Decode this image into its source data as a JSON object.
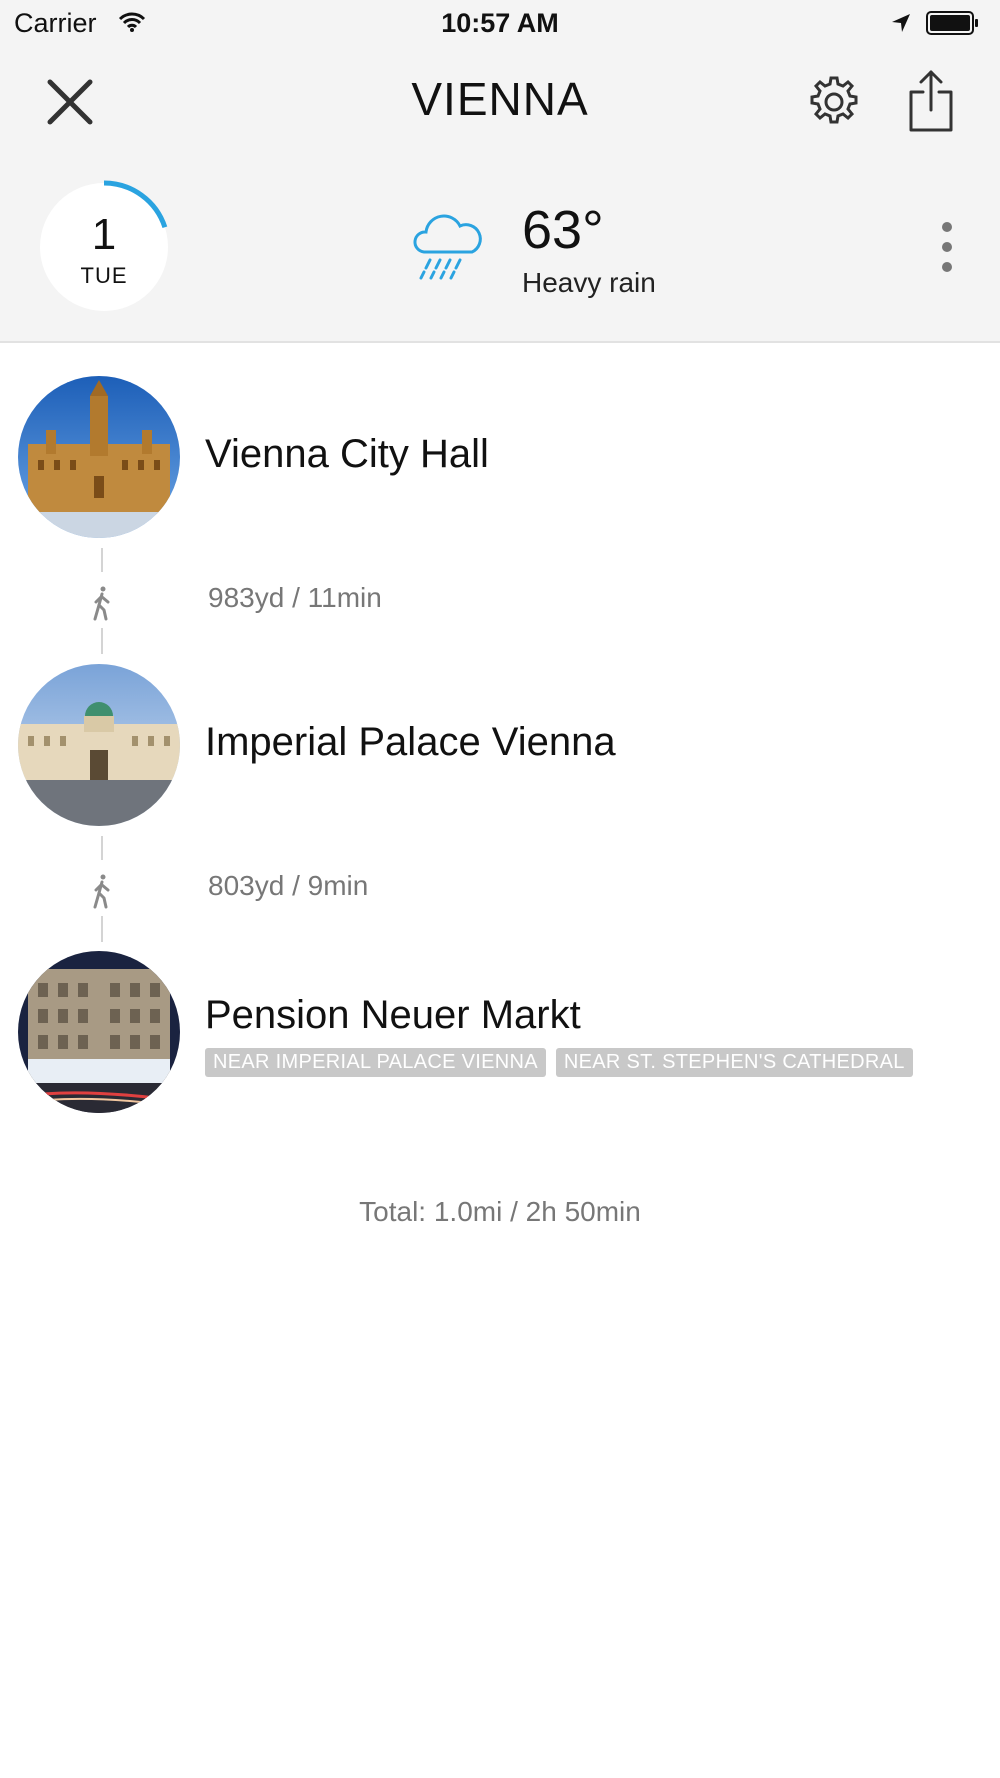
{
  "status_bar": {
    "carrier": "Carrier",
    "time": "10:57 AM"
  },
  "nav": {
    "title": "VIENNA",
    "close_icon": "close-icon",
    "settings_icon": "gear-icon",
    "share_icon": "share-icon"
  },
  "day": {
    "number": "1",
    "weekday": "TUE",
    "progress_fraction": 0.2
  },
  "weather": {
    "icon": "rain-cloud-icon",
    "temperature": "63°",
    "condition": "Heavy rain"
  },
  "places": [
    {
      "name": "Vienna City Hall",
      "image": "city-hall-photo"
    },
    {
      "name": "Imperial Palace Vienna",
      "image": "imperial-palace-photo"
    },
    {
      "name": "Pension Neuer Markt",
      "image": "pension-photo",
      "tags": [
        "NEAR IMPERIAL PALACE VIENNA",
        "NEAR ST. STEPHEN'S CATHEDRAL"
      ]
    }
  ],
  "legs": [
    {
      "mode": "walk",
      "text": "983yd / 11min"
    },
    {
      "mode": "walk",
      "text": "803yd / 9min"
    }
  ],
  "total": "Total: 1.0mi / 2h 50min",
  "colors": {
    "accent": "#2aa3e0",
    "header_bg": "#f4f4f4",
    "tag_bg": "#c8c8c8",
    "secondary_text": "#777777"
  }
}
